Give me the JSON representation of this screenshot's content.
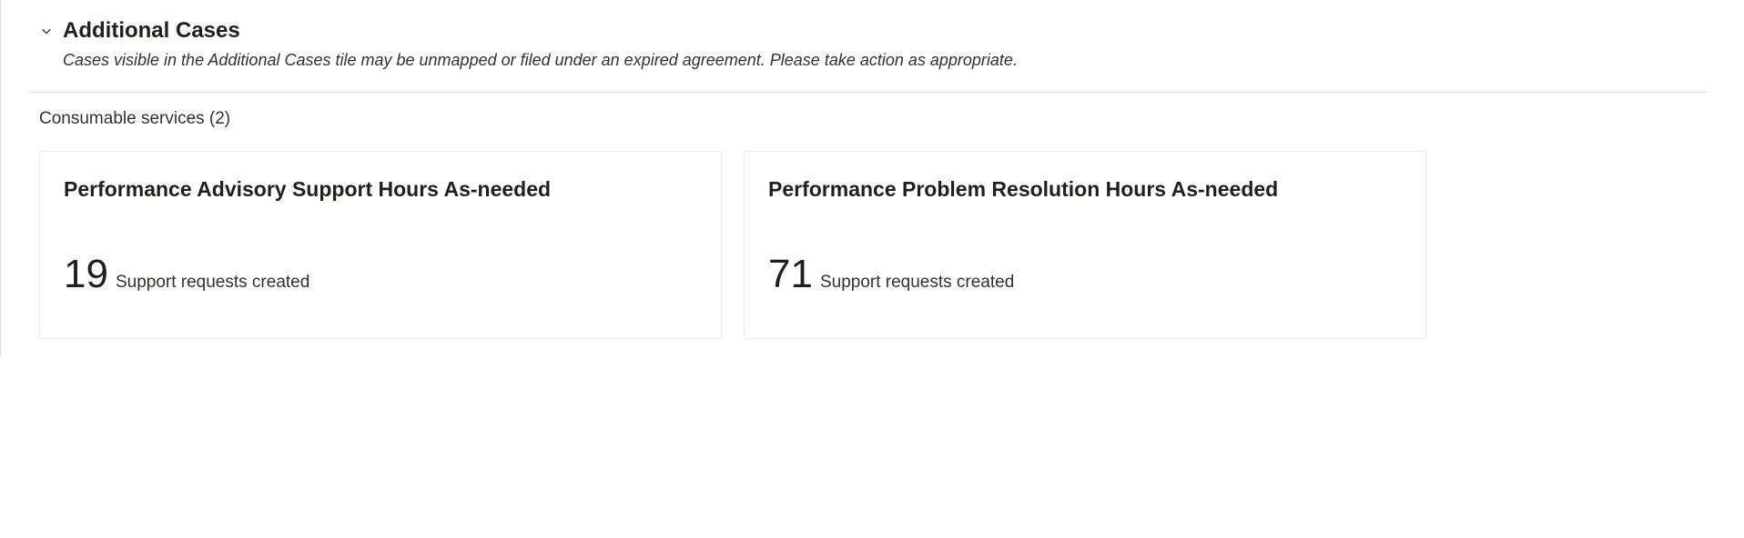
{
  "section": {
    "title": "Additional Cases",
    "subtitle": "Cases visible in the Additional Cases tile may be unmapped or filed under an expired agreement. Please take action as appropriate."
  },
  "subsection": {
    "title": "Consumable services (2)"
  },
  "cards": [
    {
      "title": "Performance Advisory Support Hours As-needed",
      "value": "19",
      "label": "Support requests created"
    },
    {
      "title": "Performance Problem Resolution Hours As-needed",
      "value": "71",
      "label": "Support requests created"
    }
  ]
}
